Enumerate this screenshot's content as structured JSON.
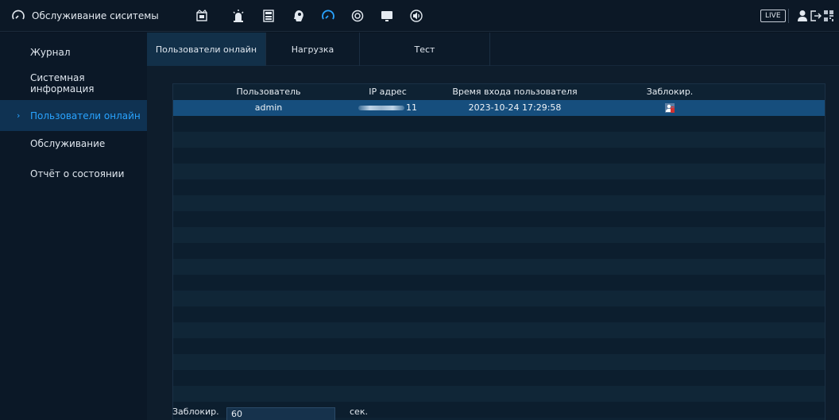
{
  "app": {
    "title": "Обслуживание сиситемы",
    "live_label": "LIVE"
  },
  "toolbar": {
    "icons": [
      "camera-icon",
      "alarm-icon",
      "storage-icon",
      "ai-icon",
      "maintenance-icon",
      "network-icon",
      "display-icon",
      "audio-icon"
    ],
    "active_icon": "maintenance-icon"
  },
  "sidebar": {
    "items": [
      {
        "label": "Журнал"
      },
      {
        "label": "Системная информация"
      },
      {
        "label": "Пользователи онлайн"
      },
      {
        "label": "Обслуживание"
      },
      {
        "label": "Отчёт о состоянии"
      }
    ],
    "active_index": 2
  },
  "tabs": [
    {
      "label": "Пользователи онлайн"
    },
    {
      "label": "Нагрузка"
    },
    {
      "label": "Тест"
    }
  ],
  "table": {
    "columns": [
      "Пользователь",
      "IP адрес",
      "Время входа пользователя",
      "Заблокир."
    ],
    "rows": [
      {
        "user": "admin",
        "ip": "11",
        "login_time": "2023-10-24 17:29:58"
      }
    ]
  },
  "block": {
    "label": "Заблокир.",
    "value": "60",
    "unit": "сек."
  },
  "colors": {
    "accent": "#29a3ff",
    "selected_row": "#164e7d",
    "active_sidebar": "#0f3252"
  }
}
